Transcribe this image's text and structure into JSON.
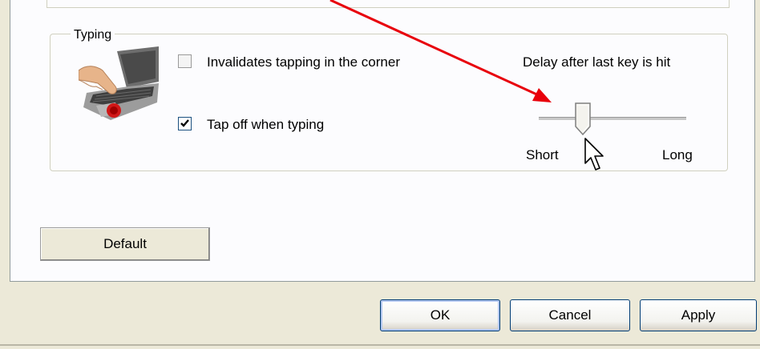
{
  "typing_group": {
    "title": "Typing",
    "invalidate_corner_label": "Invalidates tapping in the corner",
    "invalidate_corner_checked": false,
    "tap_off_label": "Tap off when typing",
    "tap_off_checked": true
  },
  "delay_slider": {
    "title": "Delay after last key is hit",
    "min_label": "Short",
    "max_label": "Long",
    "position_fraction": 0.3
  },
  "buttons": {
    "default_label": "Default",
    "ok_label": "OK",
    "cancel_label": "Cancel",
    "apply_label": "Apply"
  },
  "colors": {
    "annotation_arrow": "#e8000b",
    "dialog_background": "#ece9d8",
    "panel_background": "#fcfcfe"
  },
  "icons": [
    "touchpad-typing-illustration",
    "mouse-pointer-icon",
    "annotation-arrow"
  ]
}
